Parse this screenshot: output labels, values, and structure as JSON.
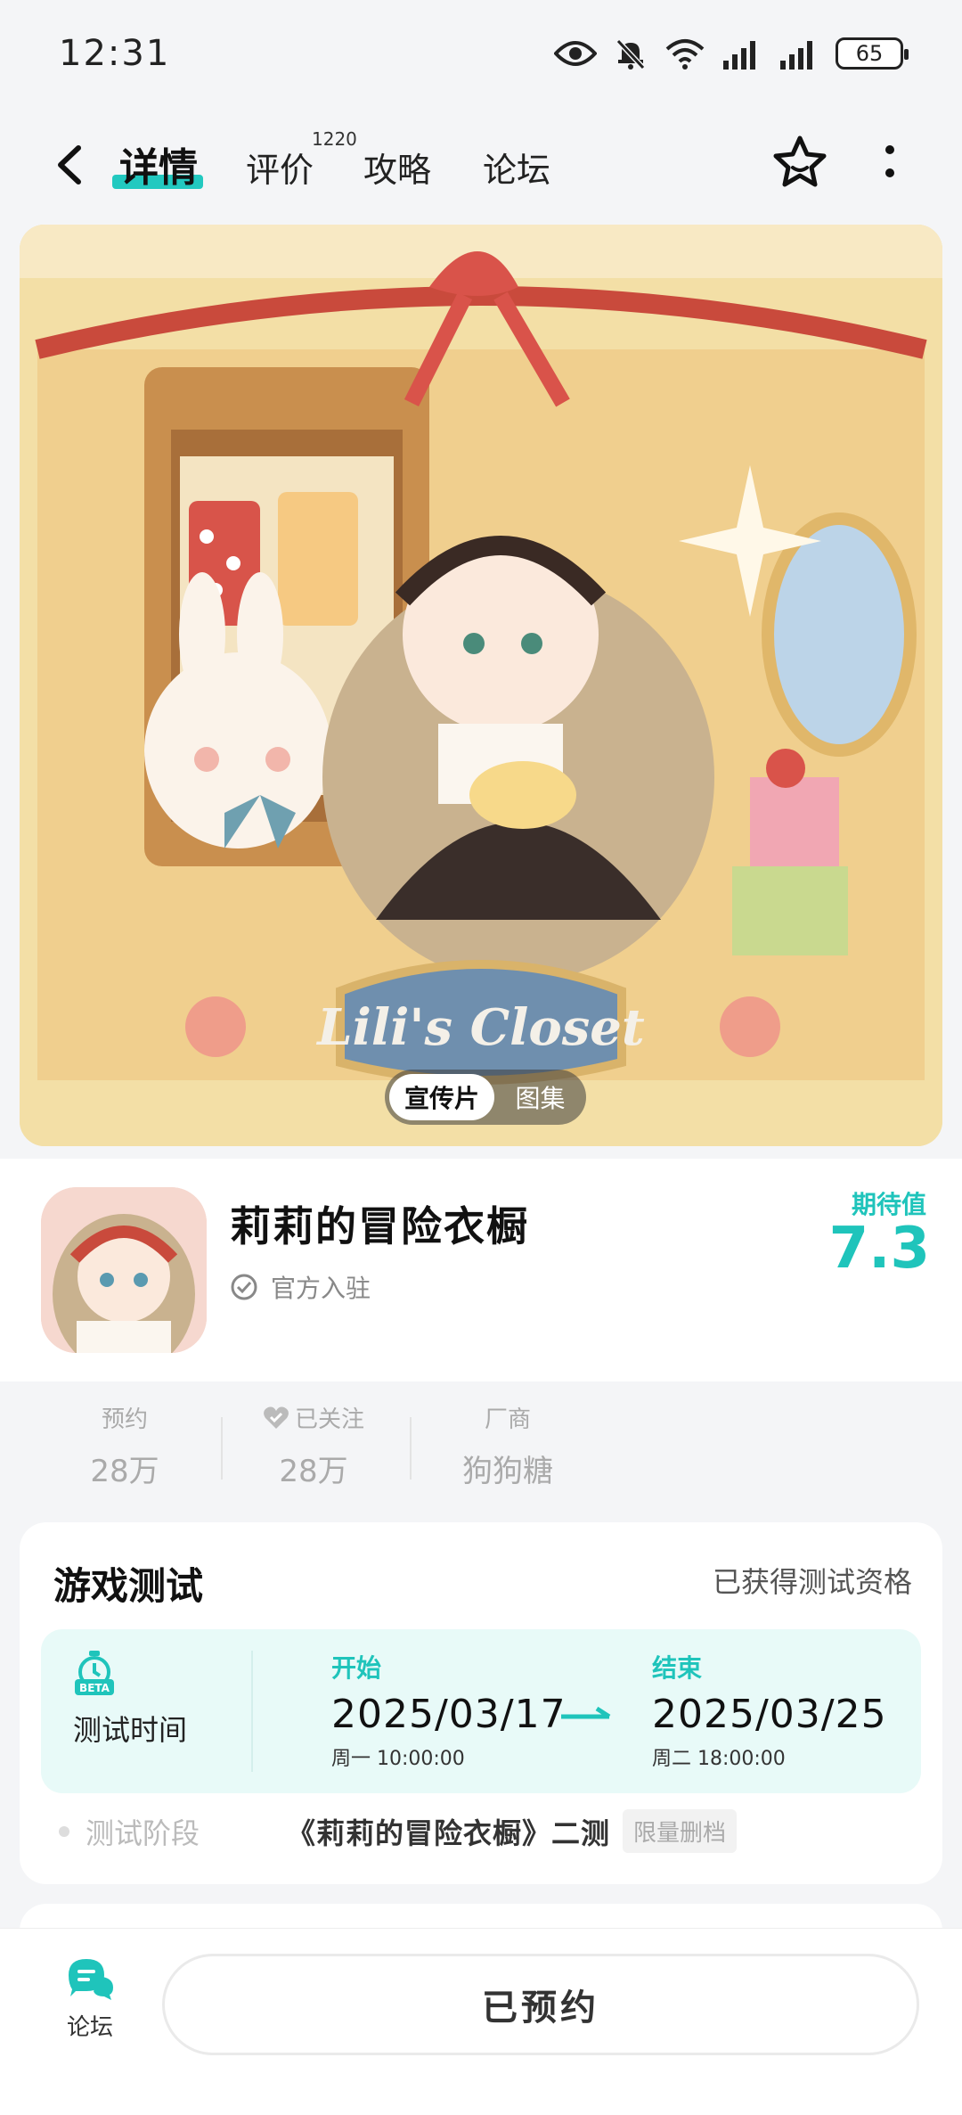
{
  "status_bar": {
    "time": "12:31",
    "battery": "65",
    "icons": [
      "eye-icon",
      "mute-bell-icon",
      "wifi-icon",
      "signal-icon",
      "signal-icon",
      "battery-icon"
    ]
  },
  "nav": {
    "tabs": [
      {
        "label": "详情",
        "active": true
      },
      {
        "label": "评价",
        "badge": "1220"
      },
      {
        "label": "攻略"
      },
      {
        "label": "论坛"
      }
    ],
    "accent": "#22c9c0"
  },
  "banner": {
    "art_title": "Lili's Closet",
    "media_options": [
      "宣传片",
      "图集"
    ]
  },
  "game": {
    "name": "莉莉的冒险衣橱",
    "official_label": "官方入驻",
    "expect_label": "期待值",
    "expect_value": "7.3"
  },
  "stats": [
    {
      "label": "预约",
      "value": "28万"
    },
    {
      "label": "已关注",
      "value": "28万"
    },
    {
      "label": "厂商",
      "value": "狗狗糖"
    }
  ],
  "test": {
    "title": "游戏测试",
    "qualification": "已获得测试资格",
    "time_label": "测试时间",
    "start_key": "开始",
    "start_date": "2025/03/17",
    "start_sub": "周一 10:00:00",
    "end_key": "结束",
    "end_date": "2025/03/25",
    "end_sub": "周二 18:00:00",
    "stage_label": "测试阶段",
    "stage_value": "《莉莉的冒险衣橱》二测",
    "stage_tag": "限量删档"
  },
  "bottom": {
    "forum_label": "论坛",
    "reserve_label": "已预约"
  }
}
